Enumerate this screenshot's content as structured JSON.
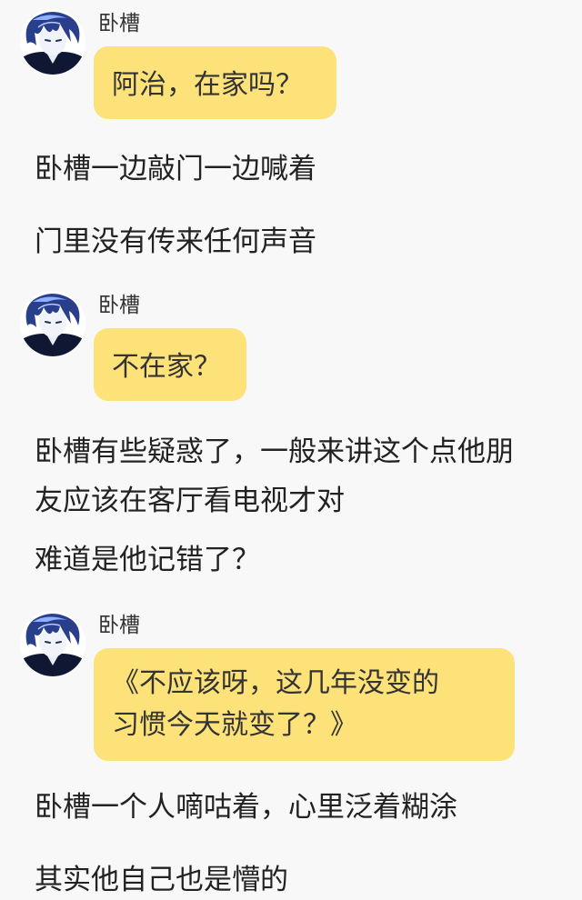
{
  "messages": [
    {
      "type": "chat",
      "sender": "卧槽",
      "text": "阿治，在家吗？"
    },
    {
      "type": "narration",
      "text": "卧槽一边敲门一边喊着"
    },
    {
      "type": "narration",
      "text": "门里没有传来任何声音"
    },
    {
      "type": "chat",
      "sender": "卧槽",
      "text": "不在家？"
    },
    {
      "type": "narration",
      "lines": [
        "卧槽有些疑惑了，一般来讲这个点他朋",
        "友应该在客厅看电视才对"
      ]
    },
    {
      "type": "narration",
      "text": "难道是他记错了？"
    },
    {
      "type": "chat",
      "sender": "卧槽",
      "lines": [
        "《不应该呀，这几年没变的",
        "习惯今天就变了？》"
      ]
    },
    {
      "type": "narration",
      "text": "卧槽一个人嘀咕着，心里泛着糊涂"
    },
    {
      "type": "narration",
      "text": "其实他自己也是懵的"
    }
  ],
  "colors": {
    "background": "#f8f8f8",
    "bubble": "#fde27a",
    "text": "#222222"
  },
  "icons": {
    "avatar": "anime-boy-avatar-icon"
  }
}
